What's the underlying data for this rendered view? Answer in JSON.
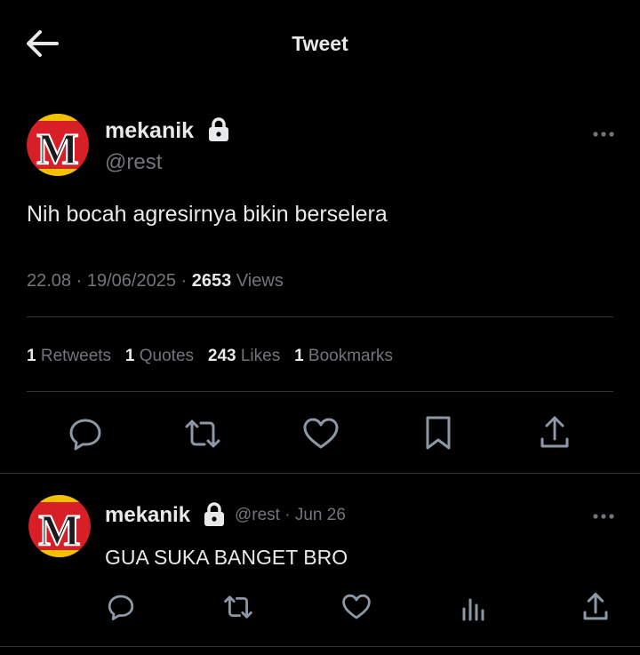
{
  "header": {
    "title": "Tweet",
    "back_icon": "arrow-left-icon"
  },
  "tweet": {
    "author": {
      "name": "mekanik",
      "handle": "@rest",
      "avatar_letter": "M",
      "protected_icon": "lock-icon"
    },
    "text": "Nih bocah agresirnya bikin berselera",
    "meta": {
      "time": "22.08",
      "sep1": "·",
      "date": "19/06/2025",
      "sep2": "·",
      "views_count": "2653",
      "views_label": "Views"
    },
    "stats": [
      {
        "count": "1",
        "label": "Retweets"
      },
      {
        "count": "1",
        "label": "Quotes"
      },
      {
        "count": "243",
        "label": "Likes"
      },
      {
        "count": "1",
        "label": "Bookmarks"
      }
    ],
    "actions": [
      "reply-icon",
      "retweet-icon",
      "like-icon",
      "bookmark-icon",
      "share-icon"
    ]
  },
  "reply": {
    "author": {
      "name": "mekanik",
      "handle": "@rest",
      "sep": "·",
      "date": "Jun 26",
      "avatar_letter": "M"
    },
    "text": "GUA SUKA BANGET BRO",
    "actions": [
      "reply-icon",
      "retweet-icon",
      "like-icon",
      "views-icon",
      "share-icon"
    ]
  },
  "colors": {
    "background": "#000000",
    "text": "#e7e9ea",
    "muted": "#71767b",
    "divider": "#2f3336",
    "avatar_red": "#d61f26"
  }
}
